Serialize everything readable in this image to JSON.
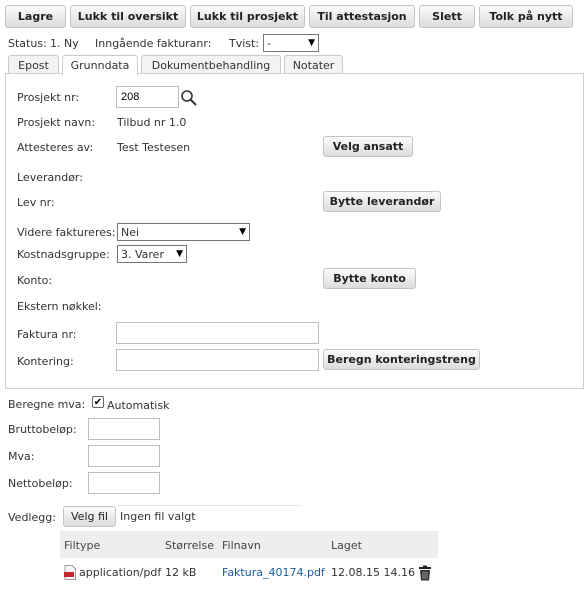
{
  "toolbar": {
    "save": "Lagre",
    "close_to_overview": "Lukk til oversikt",
    "close_to_project": "Lukk til prosjekt",
    "to_attestation": "Til attestasjon",
    "delete": "Slett",
    "interpret_again": "Tolk på nytt"
  },
  "status": {
    "status_label": "Status:",
    "status_value": "1. Ny",
    "invoice_no_label": "Inngående fakturanr:",
    "dispute_label": "Tvist:",
    "dispute_value": "-"
  },
  "tabs": [
    "Epost",
    "Grunndata",
    "Dokumentbehandling",
    "Notater"
  ],
  "active_tab": "Grunndata",
  "form": {
    "project_no_label": "Prosjekt nr:",
    "project_no_value": "208",
    "project_name_label": "Prosjekt navn:",
    "project_name_value": "Tilbud nr 1.0",
    "attested_by_label": "Attesteres av:",
    "attested_by_value": "Test Testesen",
    "select_employee_button": "Velg ansatt",
    "supplier_label": "Leverandør:",
    "supplier_no_label": "Lev nr:",
    "change_supplier_button": "Bytte leverandør",
    "reinvoice_label": "Videre faktureres:",
    "reinvoice_value": "Nei",
    "cost_group_label": "Kostnadsgruppe:",
    "cost_group_value": "3. Varer",
    "account_label": "Konto:",
    "change_account_button": "Bytte konto",
    "external_key_label": "Ekstern nøkkel:",
    "invoice_no_label": "Faktura nr:",
    "invoice_no_value": "",
    "posting_label": "Kontering:",
    "posting_value": "",
    "calc_posting_button": "Beregn konteringstreng"
  },
  "vat": {
    "calc_vat_label": "Beregne mva:",
    "automatic_label": "Automatisk",
    "automatic_checked": true,
    "gross_label": "Bruttobeløp:",
    "gross_value": "",
    "vat_label": "Mva:",
    "vat_value": "",
    "net_label": "Nettobeløp:",
    "net_value": ""
  },
  "attachment": {
    "label": "Vedlegg:",
    "choose_file_button": "Velg fil",
    "no_file_text": "Ingen fil valgt"
  },
  "files_table": {
    "headers": [
      "Filtype",
      "Størrelse",
      "Filnavn",
      "Laget"
    ],
    "rows": [
      {
        "type": "application/pdf",
        "size": "12 kB",
        "name": "Faktura_40174.pdf",
        "created": "12.08.15 14.16"
      }
    ]
  },
  "icons": {
    "search": "search-icon",
    "pdf": "pdf-icon",
    "delete": "trash-icon"
  },
  "colors": {
    "link": "#1a5b9c",
    "pdf_red": "#c0262b"
  }
}
